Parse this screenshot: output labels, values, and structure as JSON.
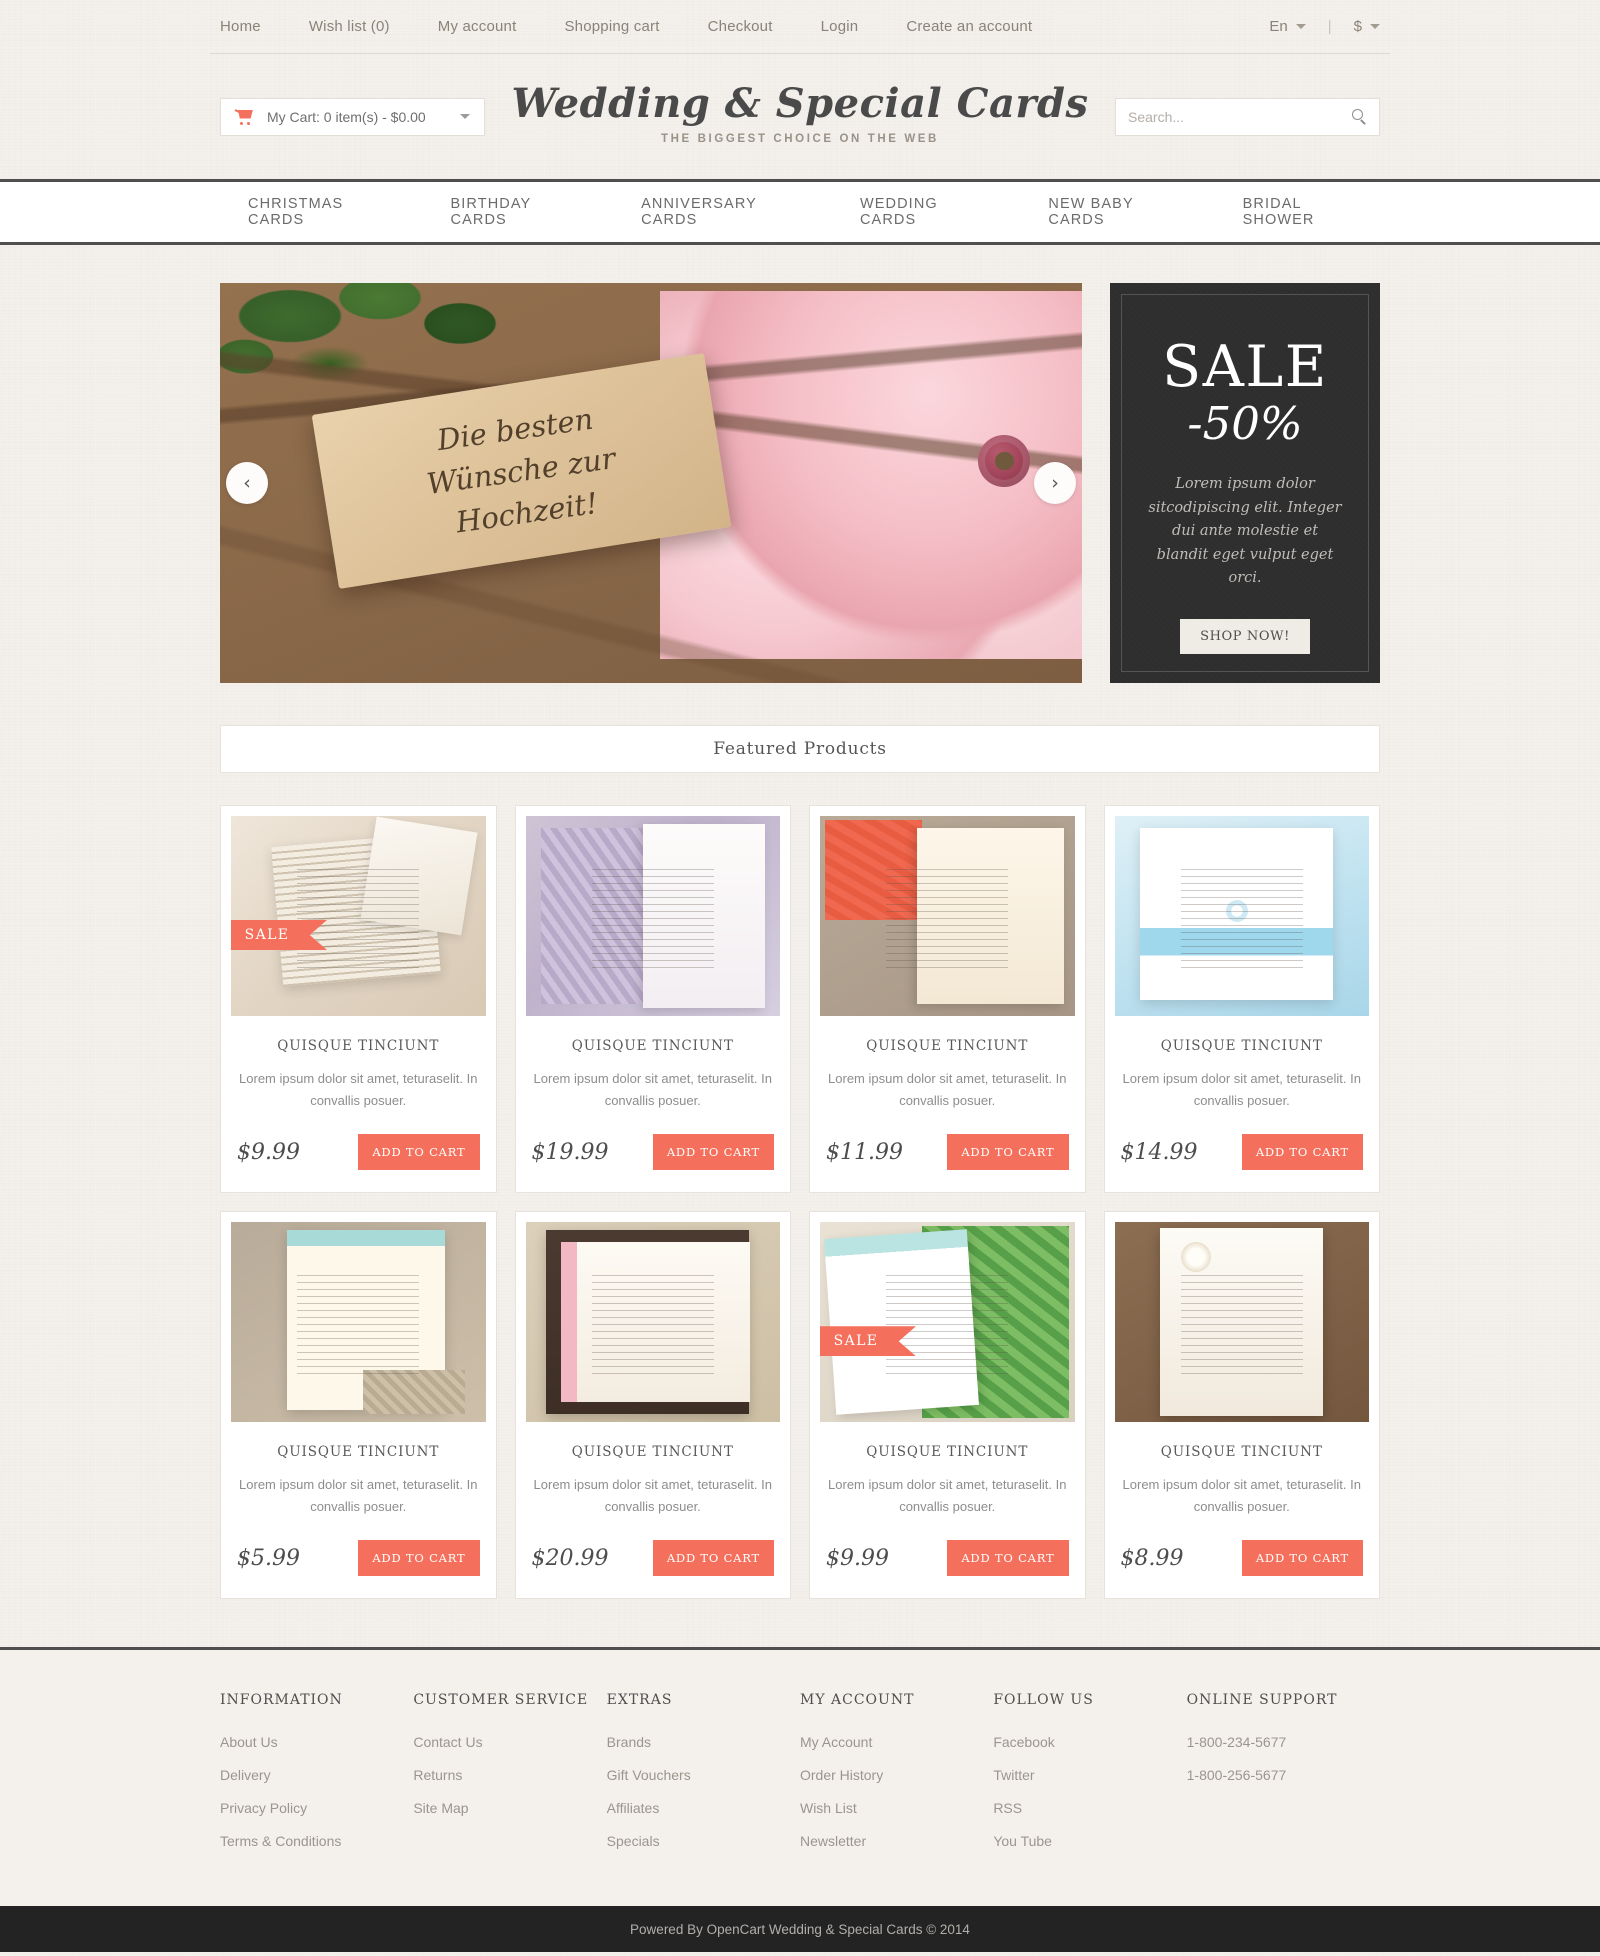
{
  "topbar": {
    "links": [
      {
        "label": "Home"
      },
      {
        "label": "Wish list (0)"
      },
      {
        "label": "My account"
      },
      {
        "label": "Shopping cart"
      },
      {
        "label": "Checkout"
      },
      {
        "label": "Login"
      },
      {
        "label": "Create an account"
      }
    ],
    "language": "En",
    "divider": "|",
    "currency": "$"
  },
  "header": {
    "cart_label": "My Cart: 0 item(s) - $0.00",
    "logo": "Wedding & Special Cards",
    "tagline": "THE BIGGEST CHOICE ON THE WEB",
    "search_placeholder": "Search...",
    "search_value": ""
  },
  "mainnav": {
    "items": [
      {
        "label": "CHRISTMAS CARDS"
      },
      {
        "label": "BIRTHDAY CARDS"
      },
      {
        "label": "ANNIVERSARY CARDS"
      },
      {
        "label": "WEDDING CARDS"
      },
      {
        "label": "NEW BABY CARDS"
      },
      {
        "label": "BRIDAL SHOWER"
      }
    ]
  },
  "slider": {
    "prev_glyph": "‹",
    "next_glyph": "›",
    "slide_text": "Die besten\nWünsche zur\nHochzeit!"
  },
  "sale_panel": {
    "headline": "SALE",
    "percent": "-50%",
    "description": "Lorem ipsum dolor sitcodipiscing elit. Integer dui ante molestie et blandit eget vulput eget orci.",
    "button": "SHOP NOW!",
    "bg_color": "#2e2e2e"
  },
  "featured": {
    "title": "Featured Products",
    "accent_color": "#f4705c",
    "products": [
      {
        "name": "QUISQUE TINCIUNT",
        "desc": "Lorem ipsum dolor sit amet, teturaselit. In convallis posuer.",
        "price": "$9.99",
        "button": "ADD TO CART",
        "sale": true,
        "sale_label": "SALE",
        "img": "p1"
      },
      {
        "name": "QUISQUE TINCIUNT",
        "desc": "Lorem ipsum dolor sit amet, teturaselit. In convallis posuer.",
        "price": "$19.99",
        "button": "ADD TO CART",
        "sale": false,
        "sale_label": "SALE",
        "img": "p2"
      },
      {
        "name": "QUISQUE TINCIUNT",
        "desc": "Lorem ipsum dolor sit amet, teturaselit. In convallis posuer.",
        "price": "$11.99",
        "button": "ADD TO CART",
        "sale": false,
        "sale_label": "SALE",
        "img": "p3"
      },
      {
        "name": "QUISQUE TINCIUNT",
        "desc": "Lorem ipsum dolor sit amet, teturaselit. In convallis posuer.",
        "price": "$14.99",
        "button": "ADD TO CART",
        "sale": false,
        "sale_label": "SALE",
        "img": "p4"
      },
      {
        "name": "QUISQUE TINCIUNT",
        "desc": "Lorem ipsum dolor sit amet, teturaselit. In convallis posuer.",
        "price": "$5.99",
        "button": "ADD TO CART",
        "sale": false,
        "sale_label": "SALE",
        "img": "p5"
      },
      {
        "name": "QUISQUE TINCIUNT",
        "desc": "Lorem ipsum dolor sit amet, teturaselit. In convallis posuer.",
        "price": "$20.99",
        "button": "ADD TO CART",
        "sale": false,
        "sale_label": "SALE",
        "img": "p6"
      },
      {
        "name": "QUISQUE TINCIUNT",
        "desc": "Lorem ipsum dolor sit amet, teturaselit. In convallis posuer.",
        "price": "$9.99",
        "button": "ADD TO CART",
        "sale": true,
        "sale_label": "SALE",
        "img": "p7"
      },
      {
        "name": "QUISQUE TINCIUNT",
        "desc": "Lorem ipsum dolor sit amet, teturaselit. In convallis posuer.",
        "price": "$8.99",
        "button": "ADD TO CART",
        "sale": false,
        "sale_label": "SALE",
        "img": "p8"
      }
    ]
  },
  "footer": {
    "columns": [
      {
        "heading": "INFORMATION",
        "links": [
          "About Us",
          "Delivery",
          "Privacy Policy",
          "Terms & Conditions"
        ]
      },
      {
        "heading": "CUSTOMER SERVICE",
        "links": [
          "Contact Us",
          "Returns",
          "Site Map"
        ]
      },
      {
        "heading": "EXTRAS",
        "links": [
          "Brands",
          "Gift Vouchers",
          "Affiliates",
          "Specials"
        ]
      },
      {
        "heading": "MY ACCOUNT",
        "links": [
          "My Account",
          "Order History",
          "Wish List",
          "Newsletter"
        ]
      },
      {
        "heading": "FOLLOW US",
        "links": [
          "Facebook",
          "Twitter",
          "RSS",
          "You Tube"
        ]
      },
      {
        "heading": "ONLINE SUPPORT",
        "links": [
          "1-800-234-5677",
          "1-800-256-5677"
        ],
        "static": true
      }
    ],
    "copyright": "Powered By OpenCart  Wedding & Special Cards  © 2014"
  }
}
